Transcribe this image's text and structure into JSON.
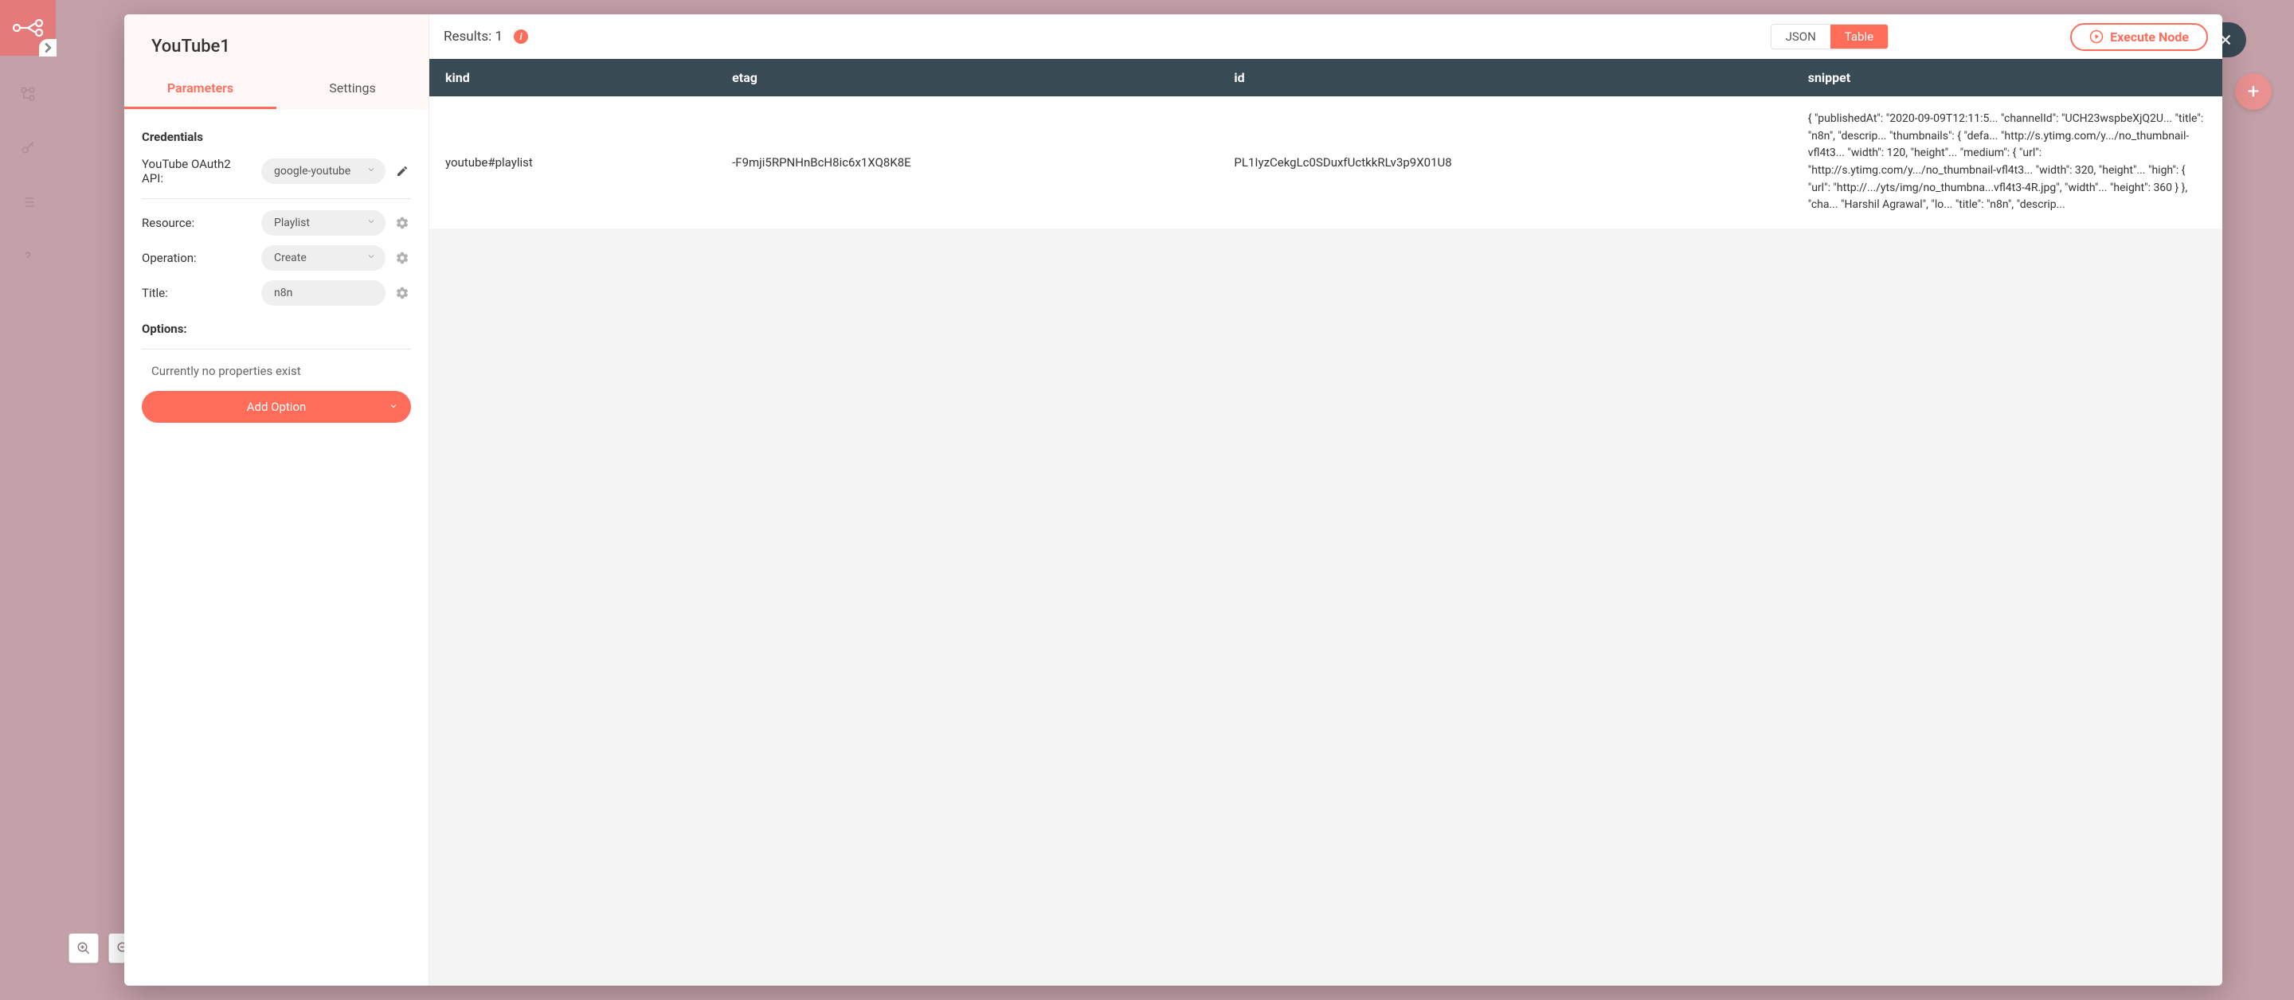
{
  "nav": {
    "icons": [
      "workflow-icon",
      "key-icon",
      "list-icon",
      "help-icon"
    ]
  },
  "modal": {
    "title": "YouTube1",
    "tabs": {
      "parameters": "Parameters",
      "settings": "Settings",
      "active": "parameters"
    },
    "credentials": {
      "section_label": "Credentials",
      "api_label": "YouTube OAuth2 API:",
      "api_value": "google-youtube"
    },
    "params": {
      "resource_label": "Resource:",
      "resource_value": "Playlist",
      "operation_label": "Operation:",
      "operation_value": "Create",
      "title_label": "Title:",
      "title_value": "n8n"
    },
    "options": {
      "label": "Options:",
      "empty_text": "Currently no properties exist",
      "add_button": "Add Option"
    }
  },
  "results": {
    "label": "Results: 1",
    "view_json": "JSON",
    "view_table": "Table",
    "execute": "Execute Node",
    "columns": [
      "kind",
      "etag",
      "id",
      "snippet"
    ],
    "row": {
      "kind": "youtube#playlist",
      "etag": "-F9mji5RPNHnBcH8ic6x1XQ8K8E",
      "id": "PL1IyzCekgLc0SDuxfUctkkRLv3p9X01U8",
      "snippet": "{ \"publishedAt\": \"2020-09-09T12:11:5... \"channelId\": \"UCH23wspbeXjQ2U... \"title\": \"n8n\", \"descrip... \"thumbnails\": { \"defa... \"http://s.ytimg.com/y.../no_thumbnail-vfl4t3... \"width\": 120, \"height\"... \"medium\": { \"url\": \"http://s.ytimg.com/y.../no_thumbnail-vfl4t3... \"width\": 320, \"height\"... \"high\": { \"url\": \"http://.../yts/img/no_thumbna...vfl4t3-4R.jpg\", \"width\"... \"height\": 360 } }, \"cha... \"Harshil Agrawal\", \"lo... \"title\": \"n8n\", \"descrip..."
    }
  }
}
